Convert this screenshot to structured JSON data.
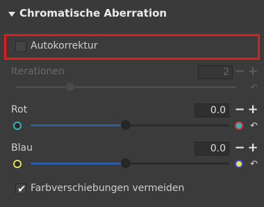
{
  "header": {
    "title": "Chromatische Aberration",
    "expand_icon": "triangle-down-icon"
  },
  "auto": {
    "label": "Autokorrektur",
    "checked": false
  },
  "iterations": {
    "label": "Iterationen",
    "value": "2",
    "disabled": true,
    "slider_fraction": 0.25,
    "minus": "−",
    "plus": "+"
  },
  "red": {
    "label": "Rot",
    "value": "0.0",
    "slider_fraction": 0.5,
    "minus": "−",
    "plus": "+",
    "left_color": "#35b5b8",
    "right_color": "#d23a3a"
  },
  "blue": {
    "label": "Blau",
    "value": "0.0",
    "slider_fraction": 0.5,
    "minus": "−",
    "plus": "+",
    "left_color": "#e6e060",
    "right_color": "#3a48d0"
  },
  "avoid_shift": {
    "label": "Farbverschiebungen vermeiden",
    "checked": true
  },
  "colors": {
    "panel_bg": "#3b3b3b",
    "highlight": "#e31b1b",
    "slider_fill": "#2d5ea4"
  },
  "icons": {
    "reset": "reset-arrow-icon",
    "check": "check-icon"
  }
}
